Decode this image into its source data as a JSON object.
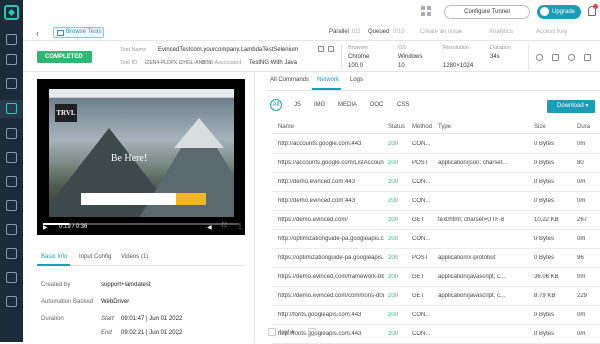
{
  "topbar": {
    "tunnel_label": "Configure Tunnel",
    "upgrade_label": "Upgrade"
  },
  "subbar": {
    "browse_label": "Browse Tests",
    "parallel_label": "Parallel",
    "parallel_value": "0/2",
    "queued_label": "Queued",
    "queued_value": "0/10",
    "issue_label": "Create an issue",
    "analytics_label": "Analytics",
    "access_label": "Access Key"
  },
  "info": {
    "status": "COMPLETED",
    "test_name_label": "Test Name",
    "test_name": "EvincedTestcom.yourcompany.LambdaTestSelenium",
    "test_id_label": "Test ID",
    "test_id": "IZEN4-PLDPX-IZHGL-ANBTY",
    "build_label": "Build Associated",
    "build": "TestNG With Java",
    "browser_label": "Browser",
    "browser": "Chrome",
    "browser_version": "100.0",
    "os_label": "OS",
    "os": "Windows",
    "os_version": "10",
    "resolution_label": "Resolution",
    "resolution": "1280×1024",
    "duration_label": "Duration",
    "duration": "34s"
  },
  "video": {
    "site_logo": "TRVL",
    "hero_text": "Be Here!",
    "time": "0:19 / 0:36",
    "progress": 0.53
  },
  "left_tabs": [
    "Basic Info",
    "Input Config",
    "Videos (1)"
  ],
  "basic_info": {
    "created_by_label": "Created by",
    "created_by": "support+lamdatest",
    "automation_label": "Automation Backed",
    "automation": "WebDriver",
    "duration_label": "Duration",
    "start_label": "Start",
    "start": "09:01:47 | Jun 01 2022",
    "end_label": "End",
    "end": "09:02:21 | Jun 01 2022"
  },
  "right_tabs": [
    "All Commands",
    "Network",
    "Logs"
  ],
  "filters": [
    "All",
    "JS",
    "IMG",
    "MEDIA",
    "DOC",
    "CSS"
  ],
  "download_label": "Download",
  "table": {
    "headers": [
      "Name",
      "Status",
      "Method",
      "Type",
      "Size",
      "Dura"
    ],
    "rows": [
      [
        "http://accounts.google.com:443",
        "200",
        "CON...",
        "",
        "0 Bytes",
        "0m"
      ],
      [
        "https://accounts.google.com/ListAccounts?gpsia...",
        "200",
        "POST",
        "application/json; charset...",
        "0 Bytes",
        "80"
      ],
      [
        "http://demo.evinced.com:443",
        "200",
        "CON...",
        "",
        "0 Bytes",
        "0m"
      ],
      [
        "http://demo.evinced.com:443",
        "200",
        "CON...",
        "",
        "0 Bytes",
        "0m"
      ],
      [
        "https://demo.evinced.com/",
        "200",
        "GET",
        "text/html; charset=UTF-8",
        "10.22 KB",
        "267"
      ],
      [
        "http://optimizationguide-pa.googleapis.com:443",
        "200",
        "CON...",
        "",
        "0 Bytes",
        "0m"
      ],
      [
        "https://optimizationguide-pa.googleapis.com/v1...",
        "200",
        "POST",
        "application/x-protobuf",
        "0 Bytes",
        "96"
      ],
      [
        "https://demo.evinced.com/framework-bbb2d30b...",
        "200",
        "GET",
        "application/javascript; c...",
        "36.06 KB",
        "0m"
      ],
      [
        "https://demo.evinced.com/commons-d0d8a239...",
        "200",
        "GET",
        "application/javascript; c...",
        "8.79 KB",
        "229"
      ],
      [
        "http://fonts.googleapis.com:443",
        "200",
        "CON...",
        "",
        "0 Bytes",
        "0m"
      ],
      [
        "http://fonts.googleapis.com:443",
        "200",
        "CON...",
        "",
        "0 Bytes",
        "0m"
      ]
    ]
  },
  "pager": {
    "page": "1",
    "of": "of 4"
  }
}
